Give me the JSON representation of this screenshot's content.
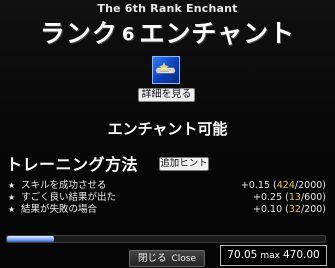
{
  "header": {
    "subtitle": "The 6th Rank Enchant",
    "title_prefix": "ランク",
    "rank_number": "6",
    "title_suffix": "エンチャント"
  },
  "item": {
    "icon": "enchant-scroll-icon",
    "detail_button": "詳細を見る"
  },
  "status": "エンチャント可能",
  "training": {
    "title": "トレーニング方法",
    "hint_button": "追加ヒント",
    "rows": [
      {
        "bullet": "★",
        "label": "スキルを成功させる",
        "bonus": "+0.15",
        "open": " (",
        "current": "424",
        "max": "/2000)"
      },
      {
        "bullet": "★",
        "label": "すごく良い結果が出た",
        "bonus": "+0.25",
        "open": " (",
        "current": "13",
        "max": "/600)"
      },
      {
        "bullet": "★",
        "label": "結果が失敗の場合",
        "bonus": "+0.10",
        "open": " (",
        "current": "32",
        "max": "/200)"
      }
    ]
  },
  "progress": {
    "fraction": 0.149
  },
  "footer": {
    "close_label": "閉じる",
    "close_label_en": "Close",
    "current_value": "70.05",
    "max_word": "max",
    "max_value": "470.00"
  },
  "colors": {
    "highlight": "#e6c84a",
    "icon_blue": "#2b7fff",
    "progress_fill": "#7fa4ff"
  }
}
